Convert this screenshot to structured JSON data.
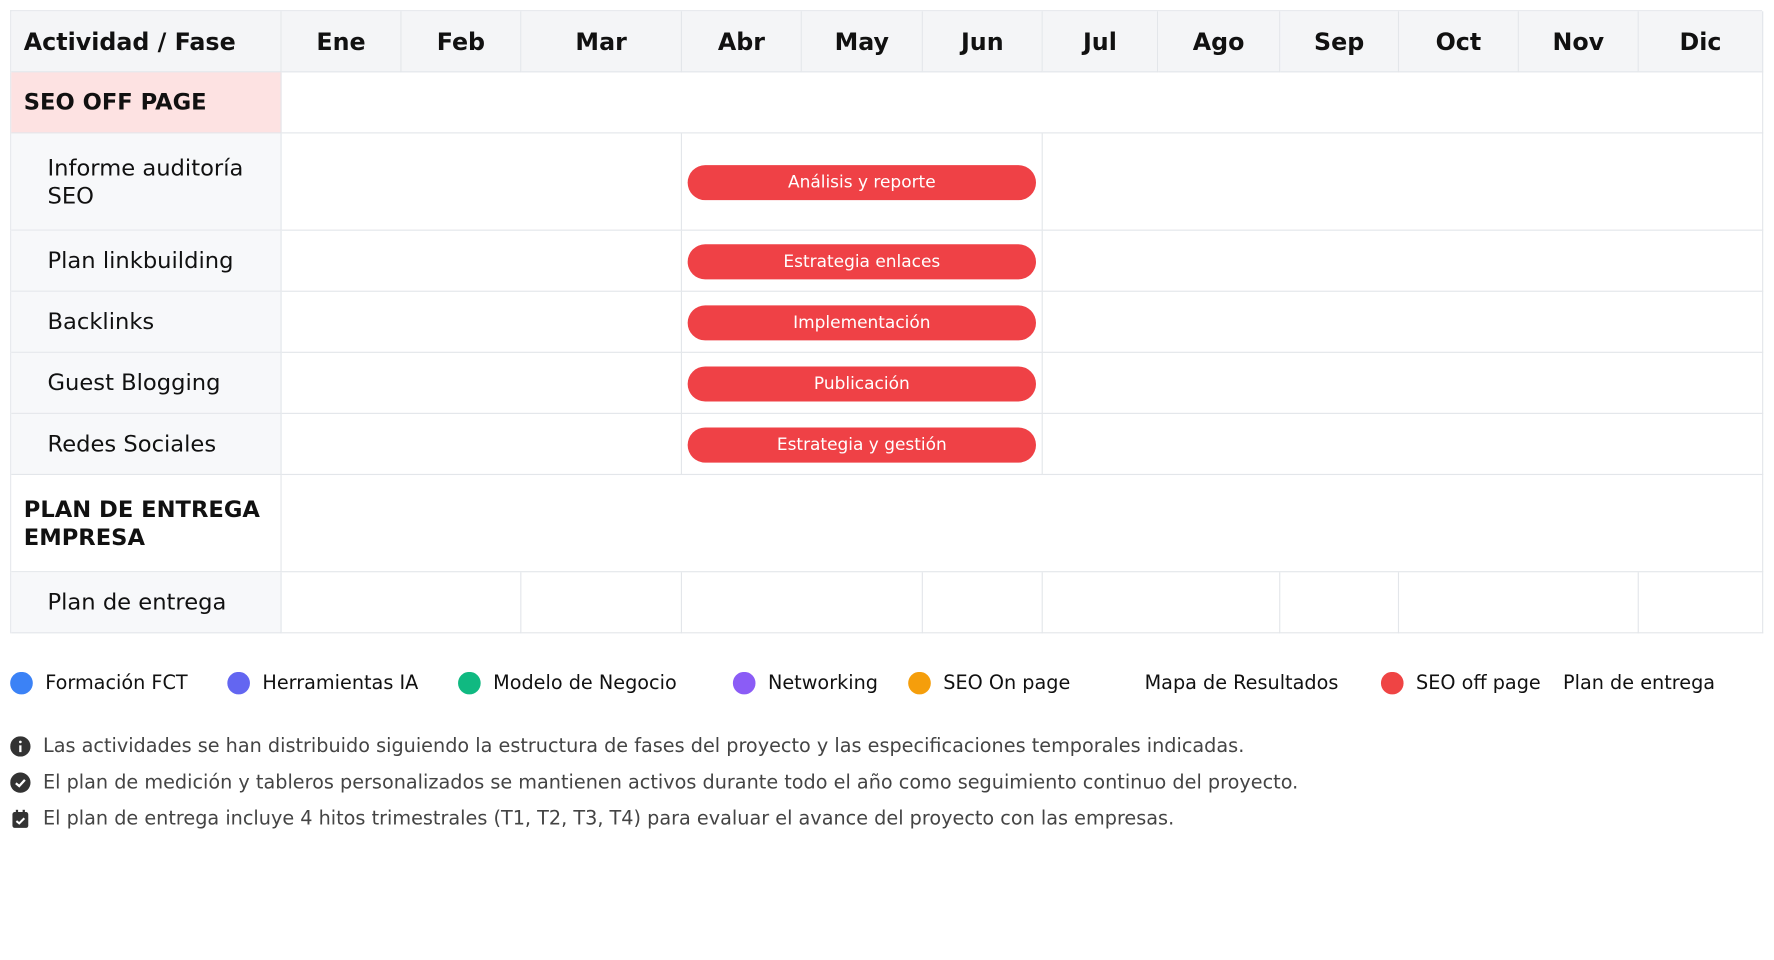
{
  "chart_data": {
    "type": "table",
    "header": {
      "first": "Actividad / Fase",
      "months": [
        "Ene",
        "Feb",
        "Mar",
        "Abr",
        "May",
        "Jun",
        "Jul",
        "Ago",
        "Sep",
        "Oct",
        "Nov",
        "Dic"
      ]
    },
    "sections": [
      {
        "title": "SEO OFF PAGE",
        "color": "#fde2e2",
        "rows": [
          {
            "label": "Informe auditoría SEO",
            "bar": {
              "text": "Análisis y reporte",
              "start": "Abr",
              "end": "Jun"
            }
          },
          {
            "label": "Plan linkbuilding",
            "bar": {
              "text": "Estrategia enlaces",
              "start": "Abr",
              "end": "Jun"
            }
          },
          {
            "label": "Backlinks",
            "bar": {
              "text": "Implementación",
              "start": "Abr",
              "end": "Jun"
            }
          },
          {
            "label": "Guest Blogging",
            "bar": {
              "text": "Publicación",
              "start": "Abr",
              "end": "Jun"
            }
          },
          {
            "label": "Redes Sociales",
            "bar": {
              "text": "Estrategia y gestión",
              "start": "Abr",
              "end": "Jun"
            }
          }
        ]
      },
      {
        "title": "PLAN DE ENTREGA EMPRESA",
        "rows": [
          {
            "label": "Plan de entrega",
            "bar": null
          }
        ]
      }
    ],
    "bar_color": "#ef4146",
    "legend": [
      {
        "label": "Formación FCT",
        "color": "#3b82f6"
      },
      {
        "label": "Herramientas IA",
        "color": "#6366f1"
      },
      {
        "label": "Modelo de Negocio",
        "color": "#10b981"
      },
      {
        "label": "Networking",
        "color": "#8b5cf6"
      },
      {
        "label": "SEO On page",
        "color": "#f59e0b"
      },
      {
        "label": "Mapa de Resultados",
        "color": ""
      },
      {
        "label": "SEO off page",
        "color": "#ef4444"
      },
      {
        "label": "Plan de entrega",
        "color": ""
      }
    ],
    "notes": [
      {
        "icon": "info-icon",
        "text": "Las actividades se han distribuido siguiendo la estructura de fases del proyecto y las especificaciones temporales indicadas."
      },
      {
        "icon": "check-circle-icon",
        "text": "El plan de medición y tableros personalizados se mantienen activos durante todo el año como seguimiento continuo del proyecto."
      },
      {
        "icon": "calendar-check-icon",
        "text": "El plan de entrega incluye 4 hitos trimestrales (T1, T2, T3, T4) para evaluar el avance del proyecto con las empresas."
      }
    ]
  }
}
